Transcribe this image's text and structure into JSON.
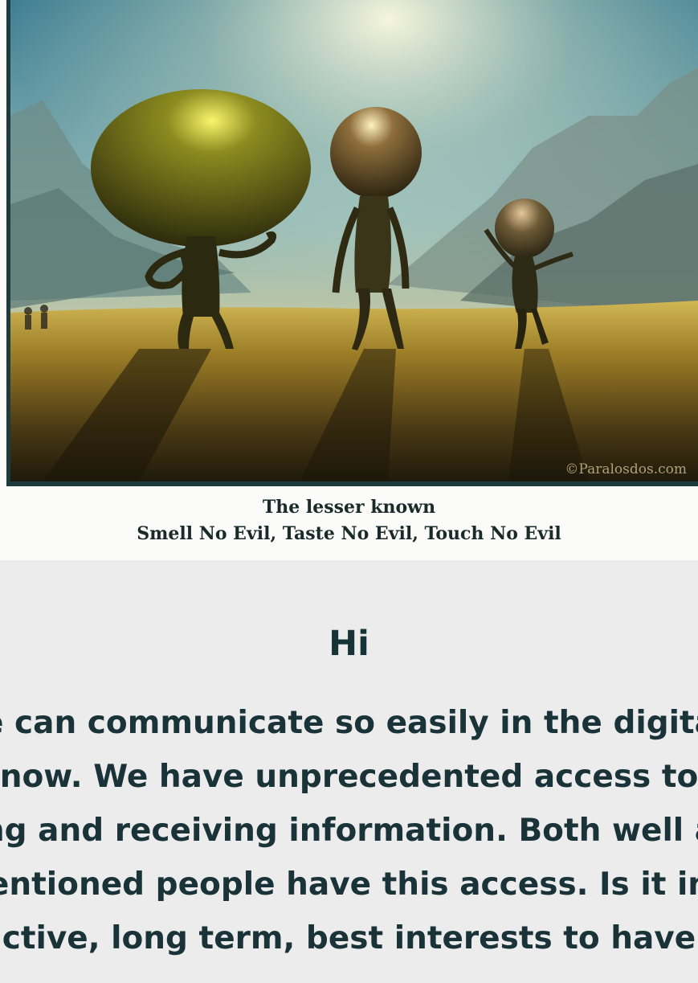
{
  "figure": {
    "watermark": "©Paralosdos.com",
    "caption_line1": "The lesser known",
    "caption_line2": "Smell No Evil, Taste No Evil, Touch No Evil"
  },
  "greeting": "Hi",
  "paragraph_lines": [
    "e can communicate so easily in the digita",
    "now. We have unprecedented access to",
    "ng and receiving information. Both well a",
    "entioned people have this access. Is it in",
    "ctive, long term, best interests to have"
  ]
}
